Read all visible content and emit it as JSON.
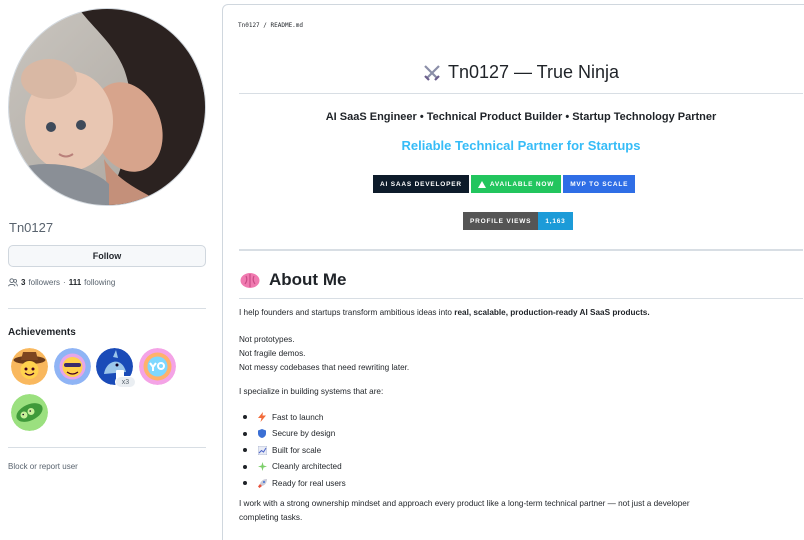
{
  "profile": {
    "username": "Tn0127",
    "follow_label": "Follow",
    "followers_count": "3",
    "followers_label": "followers",
    "separator": "·",
    "following_count": "111",
    "following_label": "following",
    "achievements_title": "Achievements",
    "achievement_badges": [
      {
        "icon": "cowboy-achievement-icon"
      },
      {
        "icon": "quickdraw-achievement-icon"
      },
      {
        "icon": "shark-achievement-icon",
        "count": "x3"
      },
      {
        "icon": "yolo-achievement-icon"
      },
      {
        "icon": "pair-extraordinaire-achievement-icon"
      }
    ],
    "block_label": "Block or report user"
  },
  "readme": {
    "breadcrumb": "Tn0127 / README.md",
    "title": "Tn0127 — True Ninja",
    "subtitle": "AI SaaS Engineer • Technical Product Builder • Startup Technology Partner",
    "tagline": "Reliable Technical Partner for Startups",
    "shields": [
      {
        "label": "AI SAAS DEVELOPER",
        "color": "#0d1b2a"
      },
      {
        "label": "AVAILABLE NOW",
        "color": "#22c55e"
      },
      {
        "label": "MVP TO SCALE",
        "color": "#2f6ee6"
      }
    ],
    "profile_views_label": "PROFILE VIEWS",
    "profile_views_value": "1,163",
    "about_heading": "About Me",
    "intro_plain": "I help founders and startups transform ambitious ideas into ",
    "intro_bold": "real, scalable, production-ready AI SaaS products.",
    "not_lines": [
      "Not prototypes.",
      "Not fragile demos.",
      "Not messy codebases that need rewriting later."
    ],
    "specialize": "I specialize in building systems that are:",
    "bullets": [
      {
        "icon": "lightning-icon",
        "text": "Fast to launch"
      },
      {
        "icon": "shield-icon",
        "text": "Secure by design"
      },
      {
        "icon": "chart-icon",
        "text": "Built for scale"
      },
      {
        "icon": "sparkles-icon",
        "text": "Cleanly architected"
      },
      {
        "icon": "rocket-icon",
        "text": "Ready for real users"
      }
    ],
    "closing_line1": "I work with a strong ownership mindset and approach every product like a long-term technical partner — not just a developer",
    "closing_line2": "completing tasks."
  },
  "colors": {
    "accent": "#36bcf7",
    "views_value_bg": "#1c9bd8",
    "views_label_bg": "#555555"
  }
}
